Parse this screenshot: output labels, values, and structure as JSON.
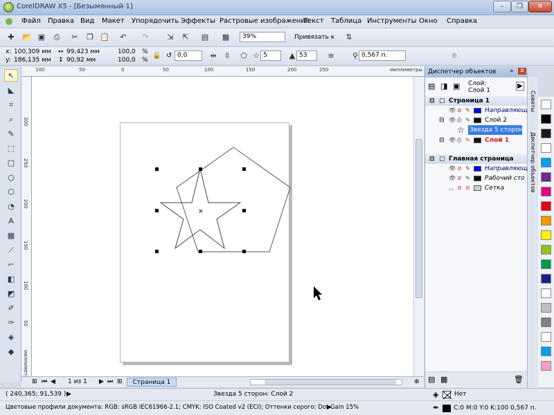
{
  "window": {
    "title": "CorelDRAW X5 - [Безымянный-1]",
    "minimize": "–",
    "restore": "❐",
    "close": "✕"
  },
  "menu": [
    "Файл",
    "Правка",
    "Вид",
    "Макет",
    "Упорядочить",
    "Эффекты",
    "Растровые изображения",
    "Текст",
    "Таблица",
    "Инструменты",
    "Окно",
    "Справка"
  ],
  "toolbar": {
    "zoom": "39%",
    "snap": "Привязать к"
  },
  "property_bar": {
    "x": "100,309 мм",
    "y": "186,135 мм",
    "width": "99,423 мм",
    "height": "90,92 мм",
    "scale_x": "100,0",
    "scale_y": "100,0",
    "percent": "%",
    "angle": "0,0",
    "points": "5",
    "sharpness": "53",
    "outline": "0,567 п."
  },
  "rulers": {
    "top": [
      "100",
      "50",
      "0",
      "50",
      "100",
      "150",
      "200",
      "250"
    ],
    "units": "миллиметры",
    "left": [
      "300",
      "250",
      "200",
      "150",
      "100",
      "50"
    ]
  },
  "pagebar": {
    "counter": "1 из 1",
    "page_tab": "Страница 1"
  },
  "docker": {
    "title": "Диспетчер объектов",
    "layer_label": "Слой:",
    "layer_value": "Слой 1",
    "rows": [
      {
        "label": "Страница 1",
        "color": "",
        "kind": "page"
      },
      {
        "label": "Направляющ",
        "color": "#0000ff",
        "kind": "layer"
      },
      {
        "label": "Слой 2",
        "color": "#111111",
        "kind": "layer"
      },
      {
        "label": "Звезда 5 сторон: С",
        "color": "",
        "kind": "object"
      },
      {
        "label": "Слой 1",
        "color": "#111111",
        "kind": "active"
      },
      {
        "label": "Главная страница",
        "color": "",
        "kind": "page"
      },
      {
        "label": "Направляющ",
        "color": "#0000ff",
        "kind": "layer"
      },
      {
        "label": "Рабочий сто",
        "color": "#111111",
        "kind": "layer"
      },
      {
        "label": "Сетка",
        "color": "#cfcfcf",
        "kind": "layer"
      }
    ],
    "side_tab_1": "Советы",
    "side_tab_2": "Диспетчер объектов"
  },
  "palette": [
    "#ffffff",
    "#000000",
    "#1a1a1a",
    "#ffffff",
    "#00a0e9",
    "#6a2c91",
    "#e6007e",
    "#e60012",
    "#f39800",
    "#fff100",
    "#8fc31f",
    "#009944",
    "#1d2088",
    "#ffffff",
    "#bfbfbf",
    "#808080",
    "#ffffff",
    "#00a0e9",
    "#ff99cc"
  ],
  "status": {
    "coords": "( 240,365; 91,539 )",
    "object_info": "Звезда  5 сторон: Слой 2",
    "color_profiles": "Цветовые профили документа: RGB: sRGB IEC61966-2.1; CMYK: ISO Coated v2 (ECI); Оттенки серого: Dot Gain 15%",
    "fill": "Нет",
    "outline": "C:0 M:0 Y:0 K:100  0,567 п."
  }
}
